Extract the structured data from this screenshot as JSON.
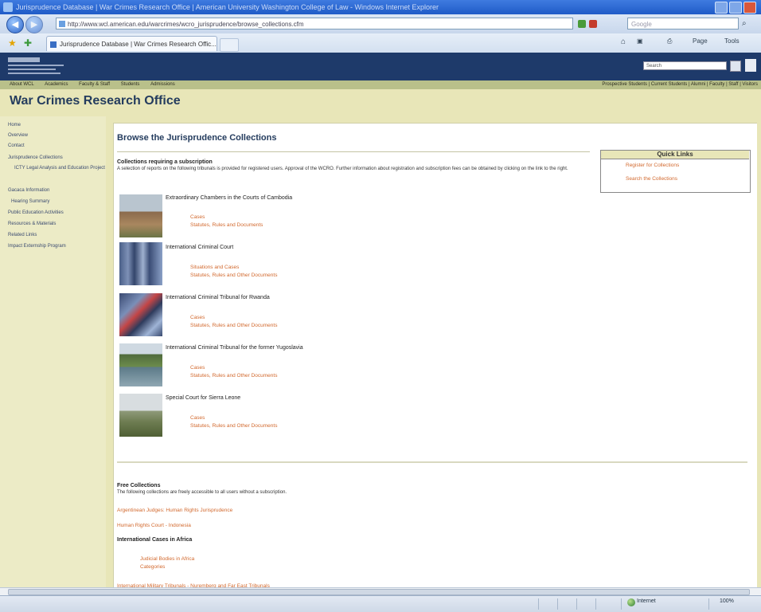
{
  "browser": {
    "title": "Jurisprudence Database | War Crimes Research Office | American University Washington College of Law - Windows Internet Explorer",
    "address": "http://www.wcl.american.edu/warcrimes/wcro_jurisprudence/browse_collections.cfm",
    "search_placeholder": "Google",
    "tab_title": "Jurisprudence Database | War Crimes Research Offic...",
    "toolbar_page": "Page",
    "toolbar_tools": "Tools",
    "status_zone": "Internet",
    "status_zoom": "100%"
  },
  "site": {
    "search_placeholder": "Search",
    "nav_left": [
      "About WCL",
      "Academics",
      "Faculty & Staff",
      "Students",
      "Admissions"
    ],
    "nav_right": "Prospective Students | Current Students | Alumni | Faculty | Staff | Visitors",
    "page_title": "War Crimes Research Office"
  },
  "left_nav": [
    "Home",
    "Overview",
    "Contact",
    "Jurisprudence Collections",
    "ICTY Legal Analysis and Education Project",
    "Gacaca Information",
    "Hearing Summary",
    "Public Education Activities",
    "Resources & Materials",
    "Related Links",
    "Impact Externship Program"
  ],
  "main": {
    "heading": "Browse the Jurisprudence Collections",
    "sub_heading": "Collections requiring a subscription",
    "description": "A selection of reports on the following tribunals is provided for registered users. Approval of the WCRO. Further information about registration and subscription fees can be obtained by clicking on the link to the right.",
    "collections": [
      {
        "name": "Extraordinary Chambers in the Courts of Cambodia",
        "links": [
          "Cases",
          "Statutes, Rules and Documents"
        ]
      },
      {
        "name": "International Criminal Court",
        "links": [
          "Situations and Cases",
          "Statutes, Rules and Other Documents"
        ]
      },
      {
        "name": "International Criminal Tribunal for Rwanda",
        "links": [
          "Cases",
          "Statutes, Rules and Other Documents"
        ]
      },
      {
        "name": "International Criminal Tribunal for the former Yugoslavia",
        "links": [
          "Cases",
          "Statutes, Rules and Other Documents"
        ]
      },
      {
        "name": "Special Court for Sierra Leone",
        "links": [
          "Cases",
          "Statutes, Rules and Other Documents"
        ]
      }
    ],
    "free_heading": "Free Collections",
    "free_description": "The following collections are freely accessible to all users without a subscription.",
    "free_links": [
      "Argentinean Judges: Human Rights Jurisprudence",
      "Human Rights Court - Indonesia"
    ],
    "ihl_heading": "International Cases in Africa",
    "ihl_links": [
      "Judicial Bodies in Africa",
      "Categories"
    ],
    "last_link": "International Military Tribunals - Nuremberg and Far East Tribunals"
  },
  "quick_links": {
    "title": "Quick Links",
    "items": [
      "Register for Collections",
      "Search the Collections"
    ]
  },
  "colors": {
    "header_blue": "#1e3a6a",
    "nav_olive": "#b9c08a",
    "banner": "#e8e6b8",
    "link_orange": "#d2692e",
    "title_navy": "#243c5e"
  }
}
